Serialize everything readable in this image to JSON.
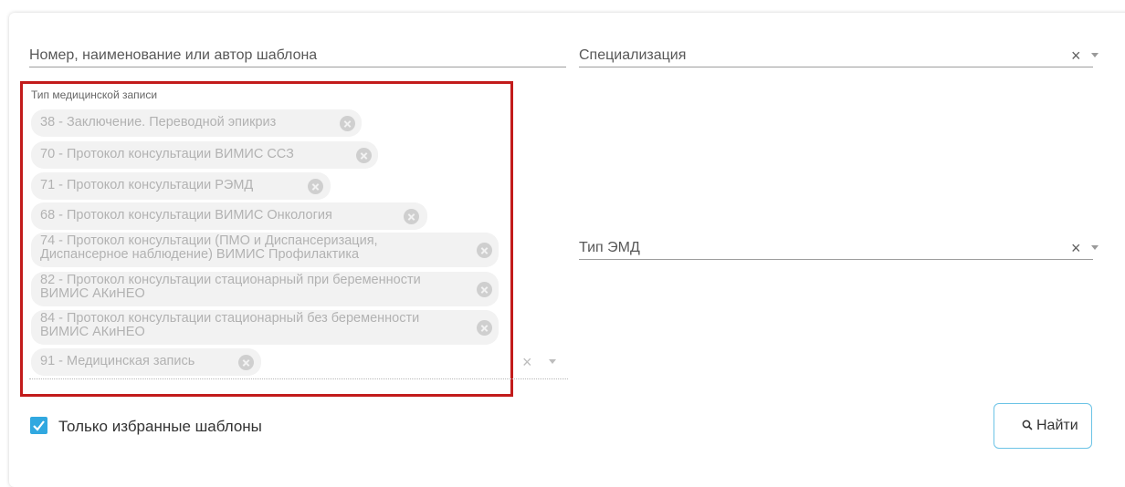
{
  "filters": {
    "search_placeholder": "Номер, наименование или автор шаблона",
    "specialization_placeholder": "Специализация",
    "emd_type_placeholder": "Тип ЭМД",
    "clear_symbol": "×"
  },
  "record_type": {
    "label": "Тип медицинской записи",
    "chips": [
      "38 - Заключение. Переводной эпикриз",
      "70 - Протокол консультации ВИМИС ССЗ",
      "71 - Протокол консультации РЭМД",
      "68 - Протокол консультации ВИМИС Онкология",
      "74 - Протокол консультации (ПМО и Диспансеризация, Диспансерное наблюдение) ВИМИС Профилактика",
      "82 - Протокол консультации стационарный при беременности ВИМИС АКиНЕО",
      "84 - Протокол консультации стационарный без беременности ВИМИС АКиНЕО",
      "91 - Медицинская запись"
    ],
    "clear_symbol": "×"
  },
  "favorites": {
    "label": "Только избранные шаблоны",
    "checked": true
  },
  "find_button": {
    "label": "Найти",
    "icon": "search-icon"
  },
  "colors": {
    "accent": "#31a8e0",
    "highlight": "#c21b1b",
    "chip_bg": "#f2f2f2"
  }
}
